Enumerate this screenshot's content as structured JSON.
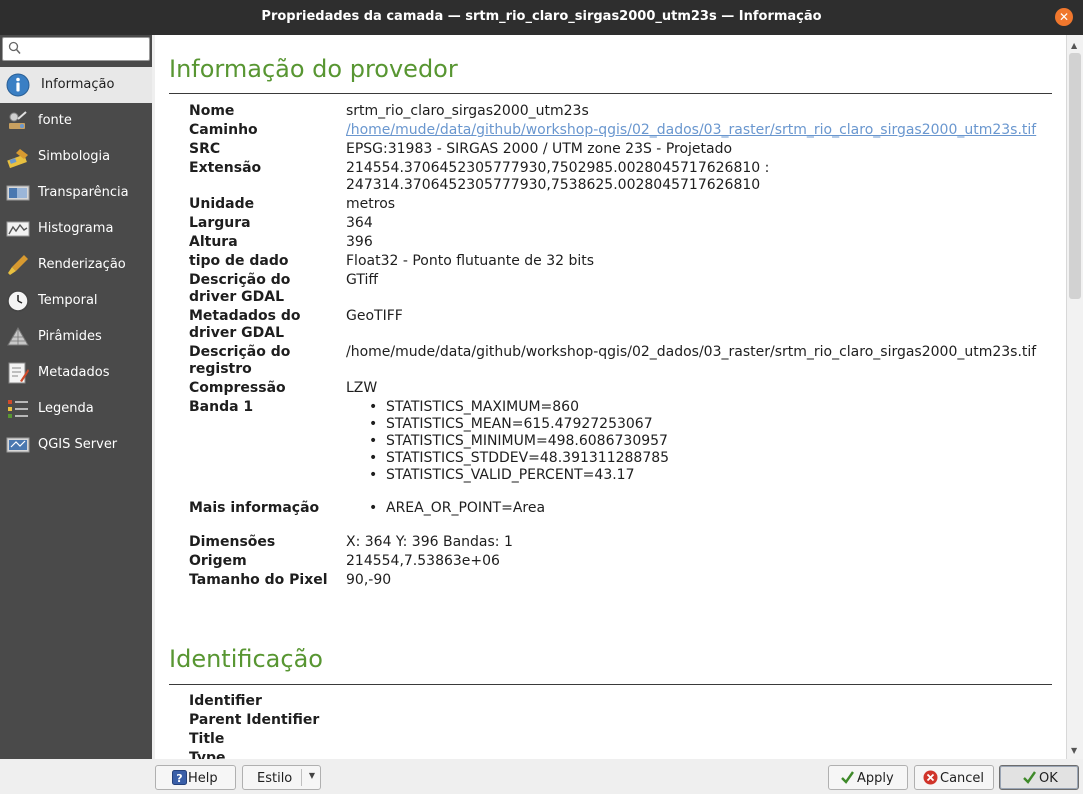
{
  "window": {
    "title": "Propriedades da camada — srtm_rio_claro_sirgas2000_utm23s — Informação",
    "close_symbol": "✕"
  },
  "sidebar": {
    "search_placeholder": "",
    "items": [
      {
        "label": "Informação",
        "icon": "info-icon",
        "active": true
      },
      {
        "label": "fonte",
        "icon": "source-icon"
      },
      {
        "label": "Simbologia",
        "icon": "symbology-icon"
      },
      {
        "label": "Transparência",
        "icon": "transparency-icon"
      },
      {
        "label": "Histograma",
        "icon": "histogram-icon"
      },
      {
        "label": "Renderização",
        "icon": "rendering-icon"
      },
      {
        "label": "Temporal",
        "icon": "clock-icon"
      },
      {
        "label": "Pirâmides",
        "icon": "pyramid-icon"
      },
      {
        "label": "Metadados",
        "icon": "metadata-icon"
      },
      {
        "label": "Legenda",
        "icon": "legend-icon"
      },
      {
        "label": "QGIS Server",
        "icon": "server-icon"
      }
    ]
  },
  "provider": {
    "heading": "Informação do provedor",
    "name_label": "Nome",
    "name": "srtm_rio_claro_sirgas2000_utm23s",
    "path_label": "Caminho",
    "path": "/home/mude/data/github/workshop-qgis/02_dados/03_raster/srtm_rio_claro_sirgas2000_utm23s.tif",
    "crs_label": "SRC",
    "crs": "EPSG:31983 - SIRGAS 2000 / UTM zone 23S - Projetado",
    "extent_label": "Extensão",
    "extent_line1": "214554.3706452305777930,7502985.0028045717626810 :",
    "extent_line2": "247314.3706452305777930,7538625.0028045717626810",
    "unit_label": "Unidade",
    "unit": "metros",
    "width_label": "Largura",
    "width": "364",
    "height_label": "Altura",
    "height": "396",
    "datatype_label": "tipo de dado",
    "datatype": "Float32 - Ponto flutuante de 32 bits",
    "gdal_desc_label1": "Descrição do",
    "gdal_desc_label2": "driver GDAL",
    "gdal_desc": "GTiff",
    "gdal_meta_label1": "Metadados do",
    "gdal_meta_label2": "driver GDAL",
    "gdal_meta": "GeoTIFF",
    "registry_label1": "Descrição do",
    "registry_label2": "registro",
    "registry": "/home/mude/data/github/workshop-qgis/02_dados/03_raster/srtm_rio_claro_sirgas2000_utm23s.tif",
    "compression_label": "Compressão",
    "compression": "LZW",
    "band_label": "Banda 1",
    "band_stats": [
      "STATISTICS_MAXIMUM=860",
      "STATISTICS_MEAN=615.47927253067",
      "STATISTICS_MINIMUM=498.6086730957",
      "STATISTICS_STDDEV=48.391311288785",
      "STATISTICS_VALID_PERCENT=43.17"
    ],
    "more_label": "Mais informação",
    "more": [
      "AREA_OR_POINT=Area"
    ],
    "dims_label": "Dimensões",
    "dims": "X: 364 Y: 396 Bandas: 1",
    "origin_label": "Origem",
    "origin": "214554,7.53863e+06",
    "pixel_label": "Tamanho do Pixel",
    "pixel": "90,-90"
  },
  "identification": {
    "heading": "Identificação",
    "fields": [
      "Identifier",
      "Parent Identifier",
      "Title",
      "Type"
    ]
  },
  "footer": {
    "help": "Help",
    "style": "Estilo",
    "apply": "Apply",
    "cancel": "Cancel",
    "ok": "OK"
  },
  "colors": {
    "heading_green": "#589632",
    "link_blue": "#6a97cf",
    "sidebar_bg": "#4a4a4a",
    "titlebar_bg": "#2e2e2e",
    "close_orange": "#f0772d"
  }
}
